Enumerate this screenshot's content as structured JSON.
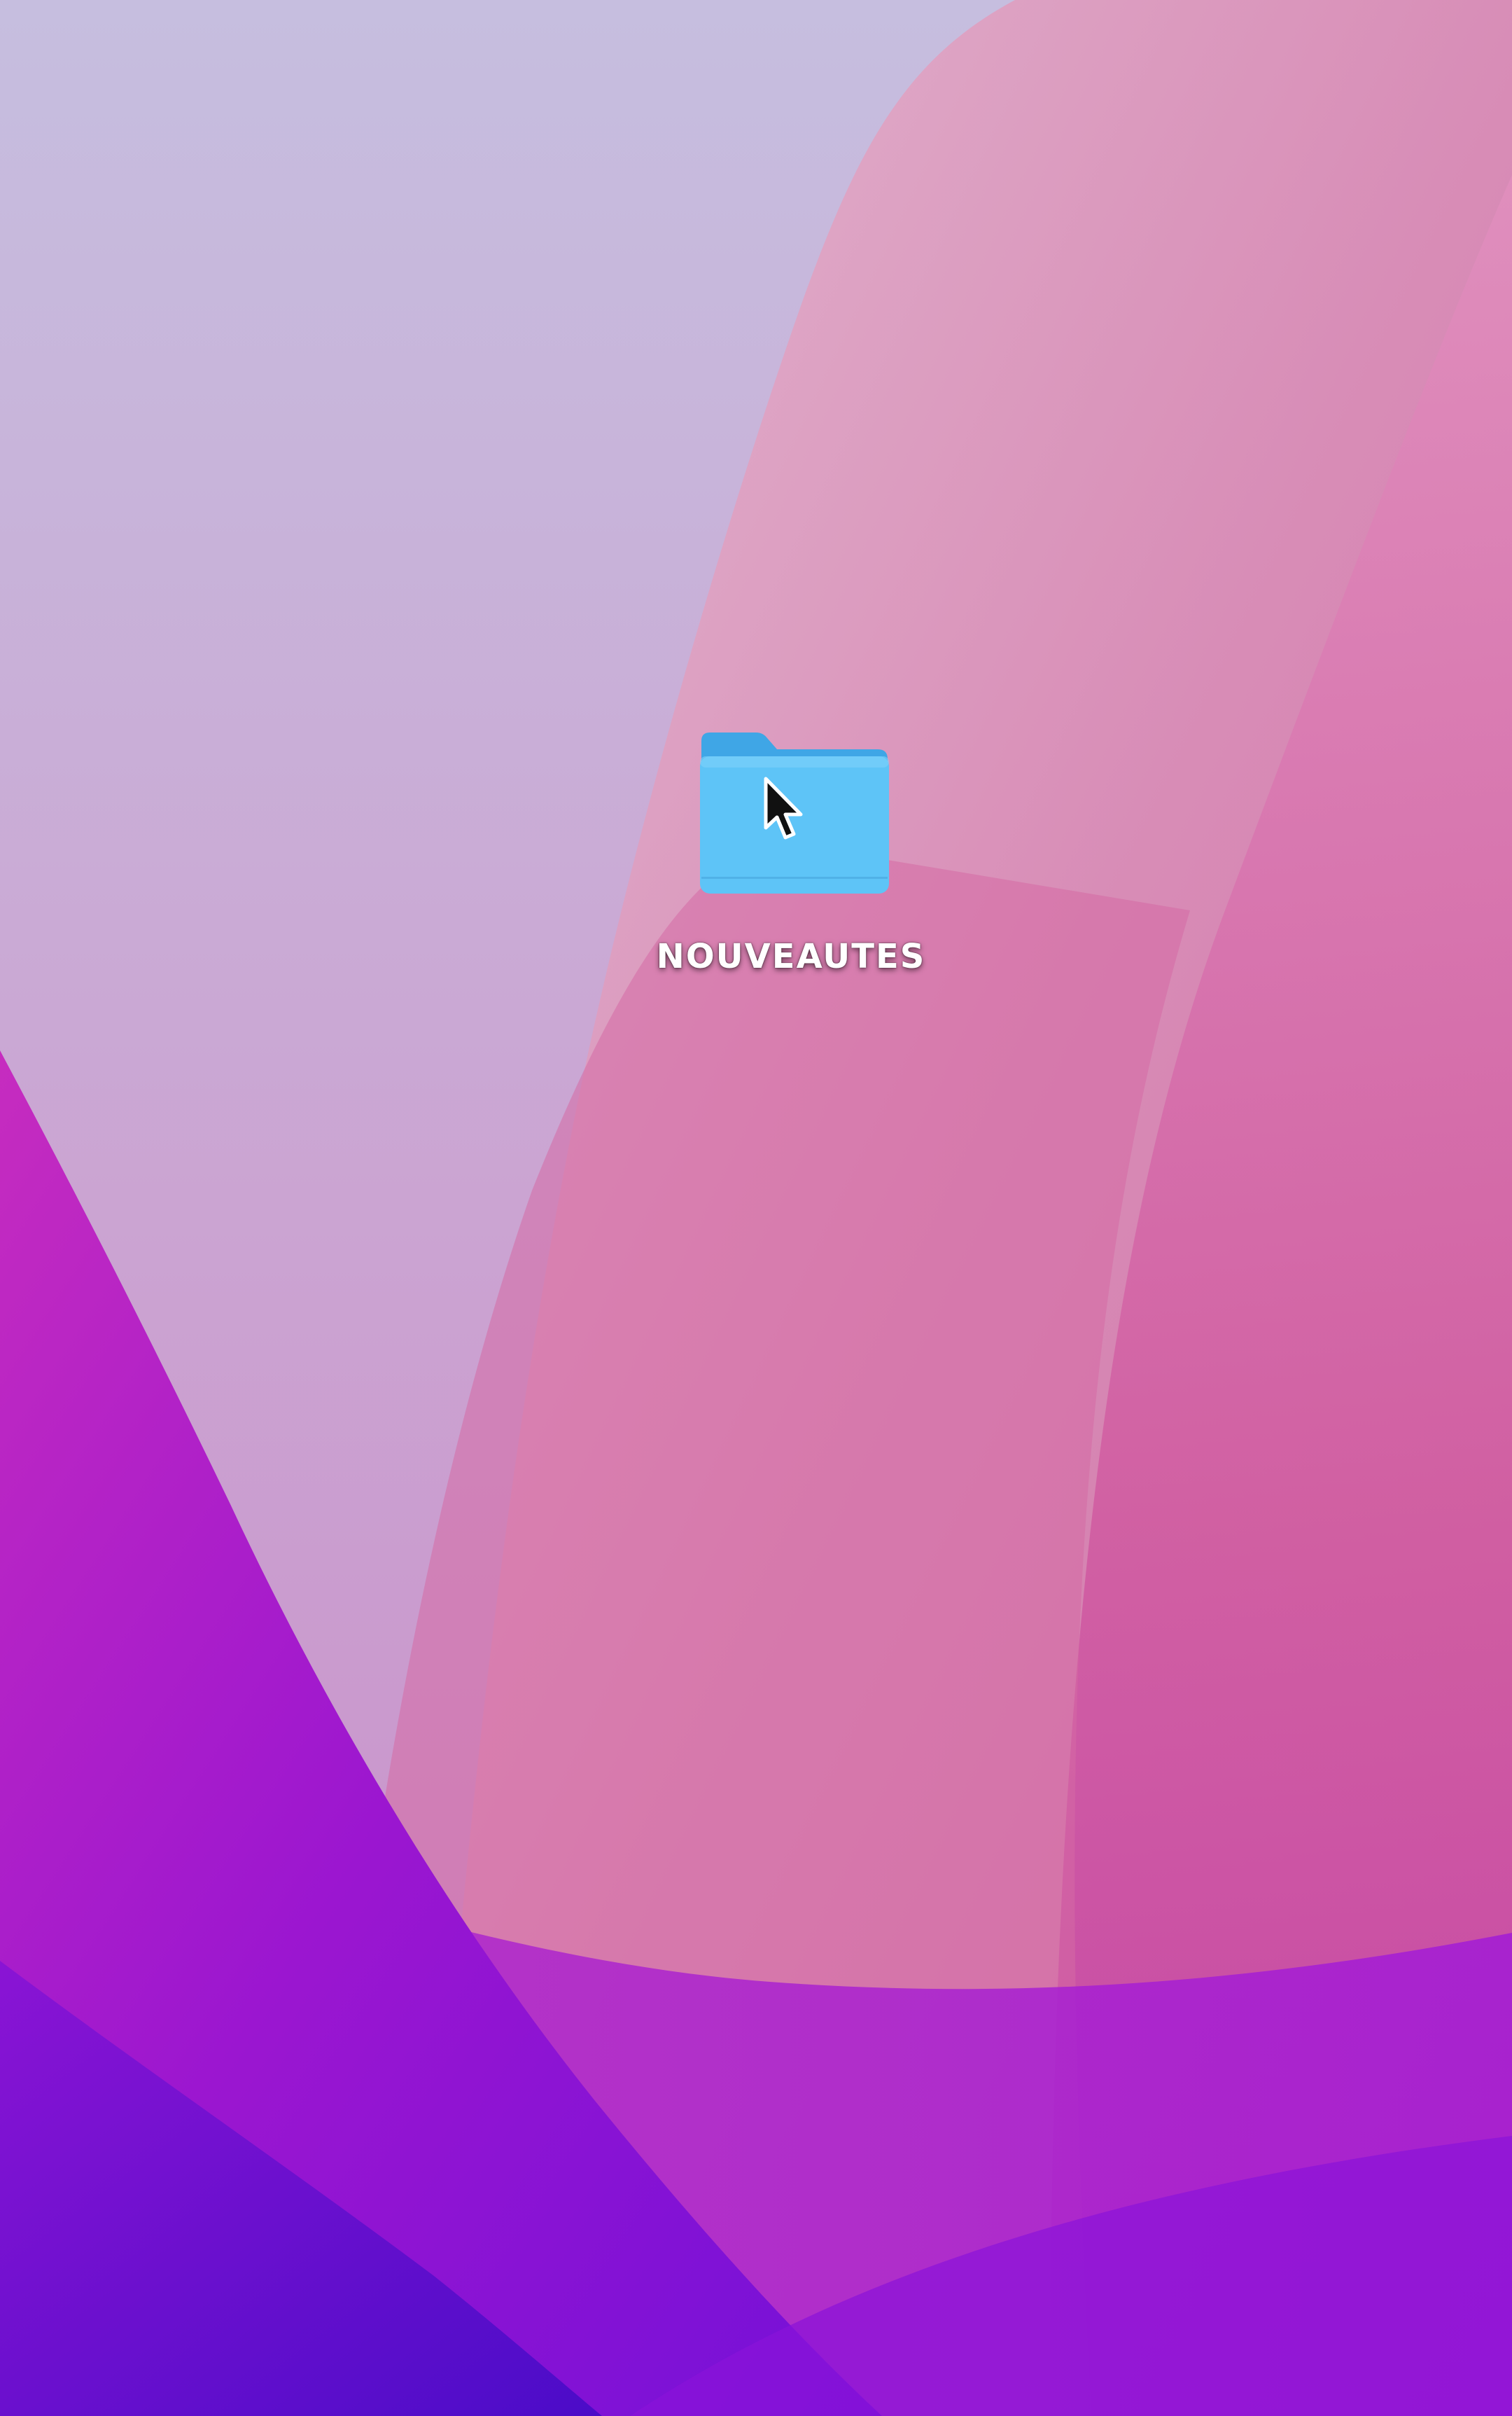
{
  "desktop": {
    "folder": {
      "name": "NOUVEAUTES",
      "icon": "folder-icon",
      "color": "#5ec4f7"
    },
    "cursor": {
      "icon": "arrow-pointer-icon"
    }
  }
}
